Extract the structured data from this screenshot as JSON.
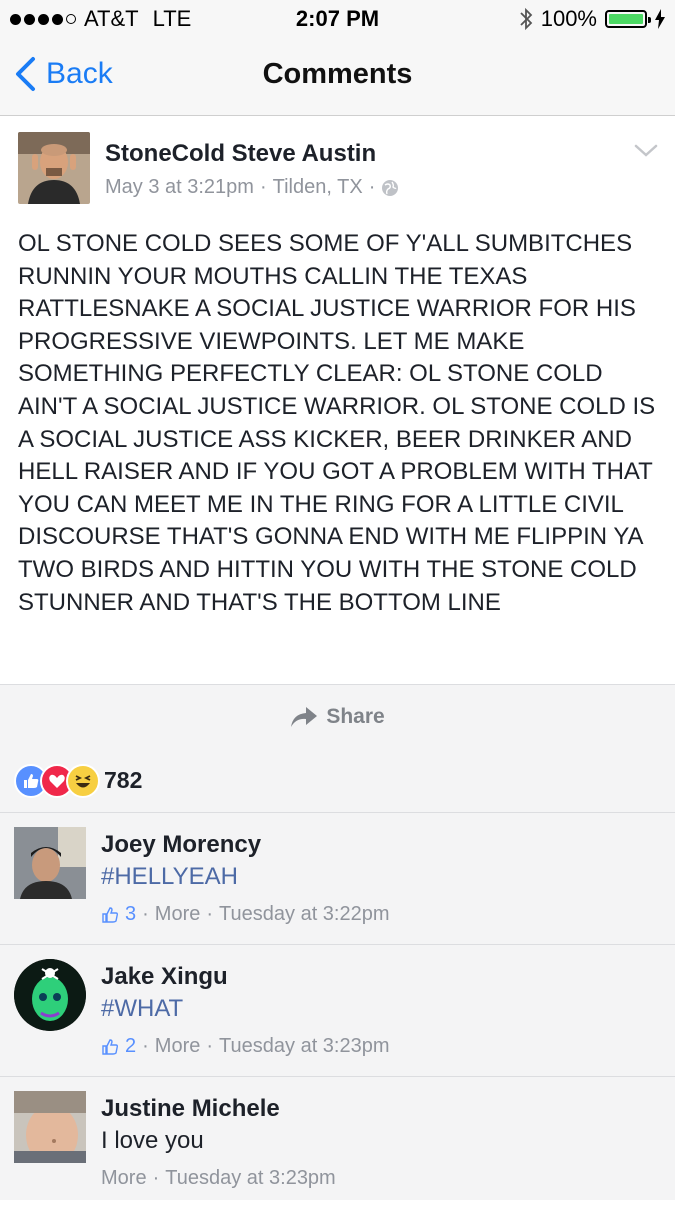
{
  "status_bar": {
    "carrier": "AT&T",
    "network": "LTE",
    "time": "2:07 PM",
    "battery": "100%"
  },
  "nav": {
    "back_label": "Back",
    "title": "Comments"
  },
  "post": {
    "author": "StoneCold Steve Austin",
    "date": "May 3 at 3:21pm",
    "location": "Tilden, TX",
    "body": "OL STONE COLD SEES SOME OF Y'ALL SUMBITCHES RUNNIN YOUR MOUTHS CALLIN THE TEXAS RATTLESNAKE A SOCIAL JUSTICE WARRIOR FOR HIS PROGRESSIVE VIEWPOINTS. LET ME MAKE SOMETHING PERFECTLY CLEAR: OL STONE COLD AIN'T A SOCIAL JUSTICE WARRIOR. OL STONE COLD IS A SOCIAL JUSTICE ASS KICKER, BEER DRINKER AND HELL RAISER AND IF YOU GOT A PROBLEM WITH THAT YOU CAN MEET ME IN THE RING FOR A LITTLE CIVIL DISCOURSE THAT'S GONNA END WITH ME FLIPPIN YA TWO BIRDS AND HITTIN YOU WITH THE STONE COLD STUNNER AND THAT'S THE BOTTOM LINE",
    "share_label": "Share",
    "reaction_count": "782"
  },
  "comments": [
    {
      "name": "Joey Morency",
      "text": "#HELLYEAH",
      "likes": "3",
      "more": "More",
      "time": "Tuesday at 3:22pm"
    },
    {
      "name": "Jake Xingu",
      "text": "#WHAT",
      "likes": "2",
      "more": "More",
      "time": "Tuesday at 3:23pm"
    },
    {
      "name": "Justine Michele",
      "text": "I love you",
      "more": "More",
      "time": "Tuesday at 3:23pm"
    }
  ],
  "colors": {
    "ios_blue": "#1a7cf5",
    "hashtag_blue": "#4d6aa6",
    "meta_gray": "#90949c",
    "battery_green": "#4cd964"
  }
}
